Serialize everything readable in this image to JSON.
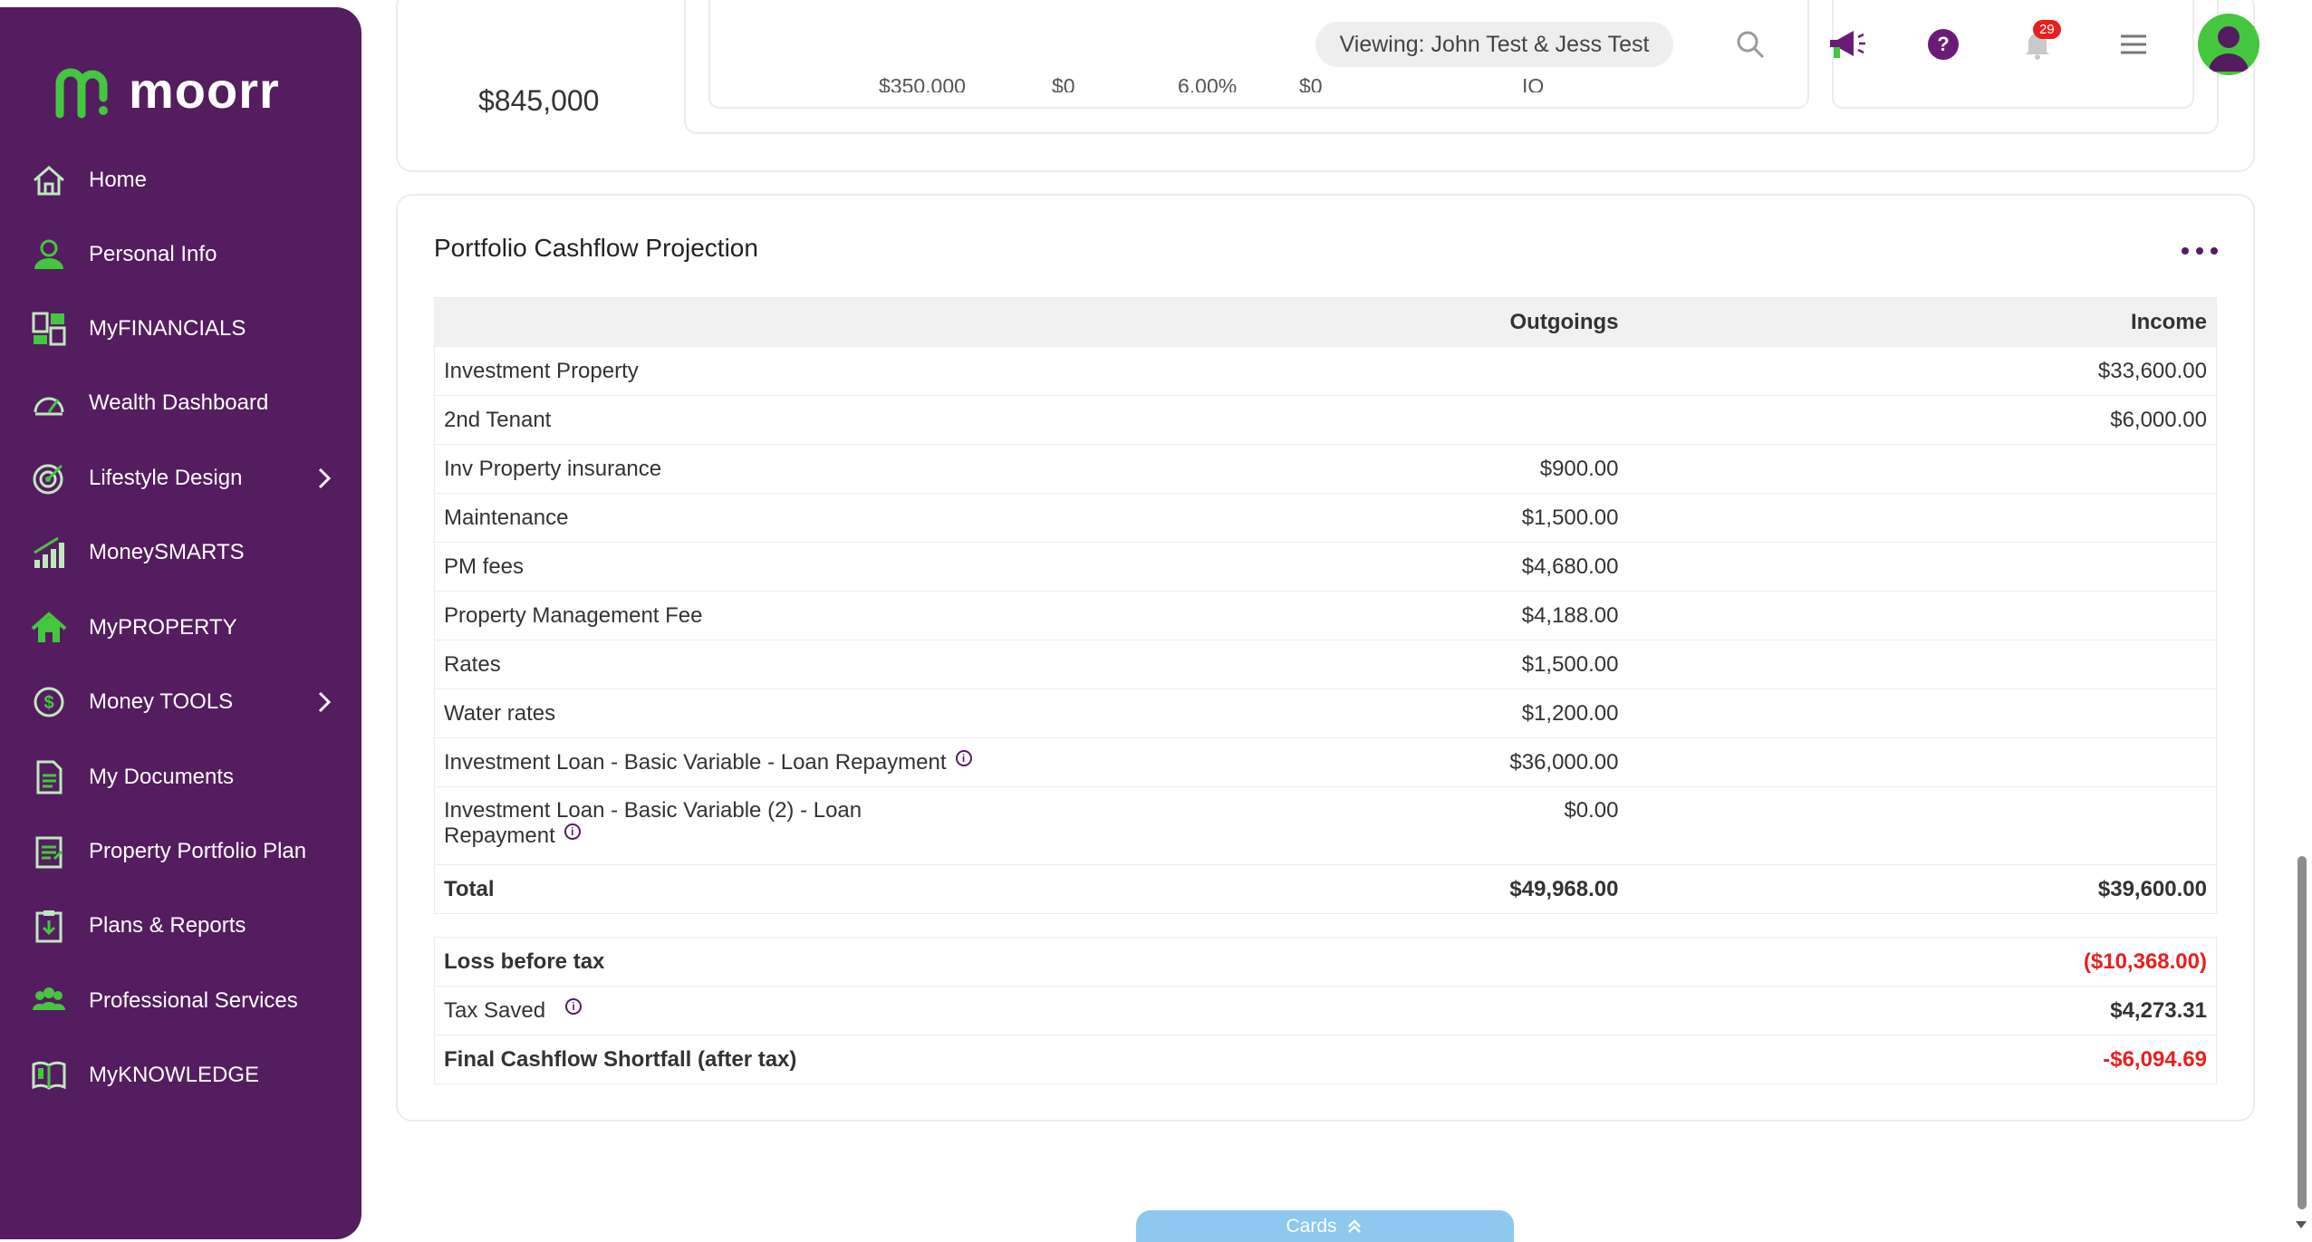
{
  "app": {
    "logo_text": "moorr"
  },
  "sidebar": {
    "items": [
      {
        "label": "Home",
        "icon": "home-icon"
      },
      {
        "label": "Personal Info",
        "icon": "person-icon"
      },
      {
        "label": "MyFINANCIALS",
        "icon": "dashboard-grid-icon"
      },
      {
        "label": "Wealth Dashboard",
        "icon": "gauge-icon"
      },
      {
        "label": "Lifestyle Design",
        "icon": "target-icon",
        "has_submenu": true
      },
      {
        "label": "MoneySMARTS",
        "icon": "bar-chart-icon"
      },
      {
        "label": "MyPROPERTY",
        "icon": "house-icon"
      },
      {
        "label": "Money TOOLS",
        "icon": "dollar-circle-icon",
        "has_submenu": true
      },
      {
        "label": "My Documents",
        "icon": "document-icon"
      },
      {
        "label": "Property Portfolio Plan",
        "icon": "clipboard-icon"
      },
      {
        "label": "Plans & Reports",
        "icon": "download-report-icon"
      },
      {
        "label": "Professional Services",
        "icon": "people-icon"
      },
      {
        "label": "MyKNOWLEDGE",
        "icon": "book-icon"
      }
    ]
  },
  "header": {
    "viewing_label": "Viewing: John Test & Jess Test",
    "notification_count": "29"
  },
  "top_card": {
    "amount": "$845,000",
    "cut_values": [
      "$350,000",
      "$0",
      "6.00%",
      "$0",
      "IO"
    ]
  },
  "projection": {
    "title": "Portfolio Cashflow Projection",
    "columns": {
      "outgoings": "Outgoings",
      "income": "Income"
    },
    "rows": [
      {
        "label": "Investment Property",
        "outgoings": "",
        "income": "$33,600.00"
      },
      {
        "label": "2nd Tenant",
        "outgoings": "",
        "income": "$6,000.00"
      },
      {
        "label": "Inv Property insurance",
        "outgoings": "$900.00",
        "income": ""
      },
      {
        "label": "Maintenance",
        "outgoings": "$1,500.00",
        "income": ""
      },
      {
        "label": "PM fees",
        "outgoings": "$4,680.00",
        "income": ""
      },
      {
        "label": "Property Management Fee",
        "outgoings": "$4,188.00",
        "income": ""
      },
      {
        "label": "Rates",
        "outgoings": "$1,500.00",
        "income": ""
      },
      {
        "label": "Water rates",
        "outgoings": "$1,200.00",
        "income": ""
      },
      {
        "label": "Investment Loan - Basic Variable - Loan Repayment",
        "outgoings": "$36,000.00",
        "income": ""
      },
      {
        "label_line1": "Investment Loan - Basic Variable (2) - Loan",
        "label_line2": "Repayment",
        "outgoings": "$0.00",
        "income": ""
      }
    ],
    "total": {
      "label": "Total",
      "outgoings": "$49,968.00",
      "income": "$39,600.00"
    },
    "summary": [
      {
        "label": "Loss before tax",
        "value": "($10,368.00)"
      },
      {
        "label": "Tax Saved",
        "value": "$4,273.31"
      },
      {
        "label": "Final Cashflow Shortfall (after tax)",
        "value": "-$6,094.69"
      }
    ]
  },
  "cards_tab": {
    "label": "Cards"
  },
  "colors": {
    "brand_purple": "#541d5f",
    "brand_green": "#44c73f",
    "negative": "#e8201f",
    "cards_tab": "#8ec8ee"
  }
}
